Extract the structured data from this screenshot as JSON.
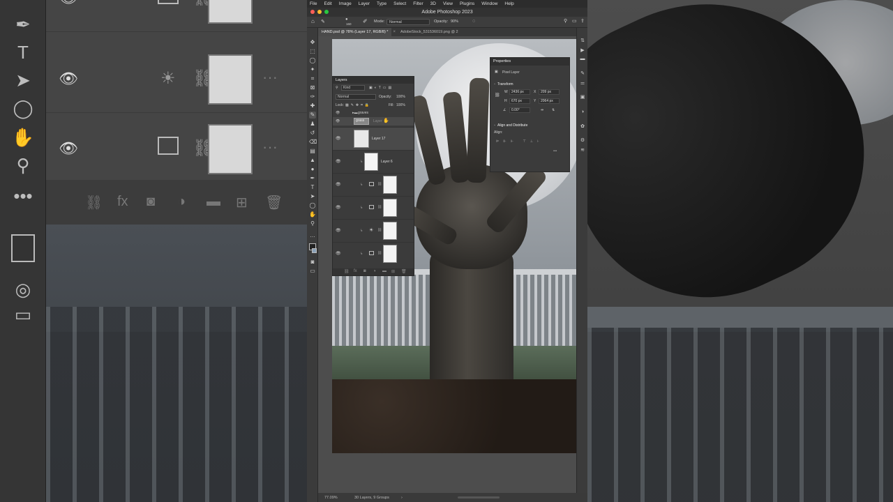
{
  "app": {
    "title": "Adobe Photoshop 2023",
    "menu": [
      "File",
      "Edit",
      "Image",
      "Layer",
      "Type",
      "Select",
      "Filter",
      "3D",
      "View",
      "Plugins",
      "Window",
      "Help"
    ]
  },
  "options": {
    "brush_size": "160",
    "mode_label": "Mode:",
    "mode_value": "Normal",
    "opacity_label": "Opacity:",
    "opacity_value": "90%"
  },
  "tabs": [
    {
      "label": "HAND.psd @ 78% (Layer 17, RGB/8) *"
    },
    {
      "label": "AdobeStock_531536019.png @ 2"
    }
  ],
  "layers_panel": {
    "title": "Layers",
    "filter_kind": "Kind",
    "blend_mode": "Normal",
    "opacity_label": "Opacity:",
    "opacity_value": "100%",
    "lock_label": "Lock:",
    "fill_label": "Fill:",
    "fill_value": "100%",
    "group_name": "graves",
    "group2_name": "grass",
    "drag_label": "Layer",
    "items": [
      {
        "name": "Layer 17"
      },
      {
        "name": "Layer 6"
      },
      {
        "name": ""
      },
      {
        "name": ""
      },
      {
        "name": ""
      },
      {
        "name": ""
      }
    ]
  },
  "properties_panel": {
    "title": "Properties",
    "kind": "Pixel Layer",
    "transform_label": "Transform",
    "w_label": "W",
    "w_value": "2436 px",
    "x_label": "X",
    "x_value": "209 px",
    "h_label": "H",
    "h_value": "670 px",
    "y_label": "Y",
    "y_value": "2064 px",
    "angle_value": "0.00°",
    "align_section": "Align and Distribute",
    "align_label": "Align:"
  },
  "status": {
    "zoom": "77.09%",
    "info": "30 Layers, 9 Groups"
  },
  "colors": {
    "panel": "#3b3b3b",
    "canvas_bg": "#4d4d4d",
    "menubar": "#2c2c2c"
  }
}
